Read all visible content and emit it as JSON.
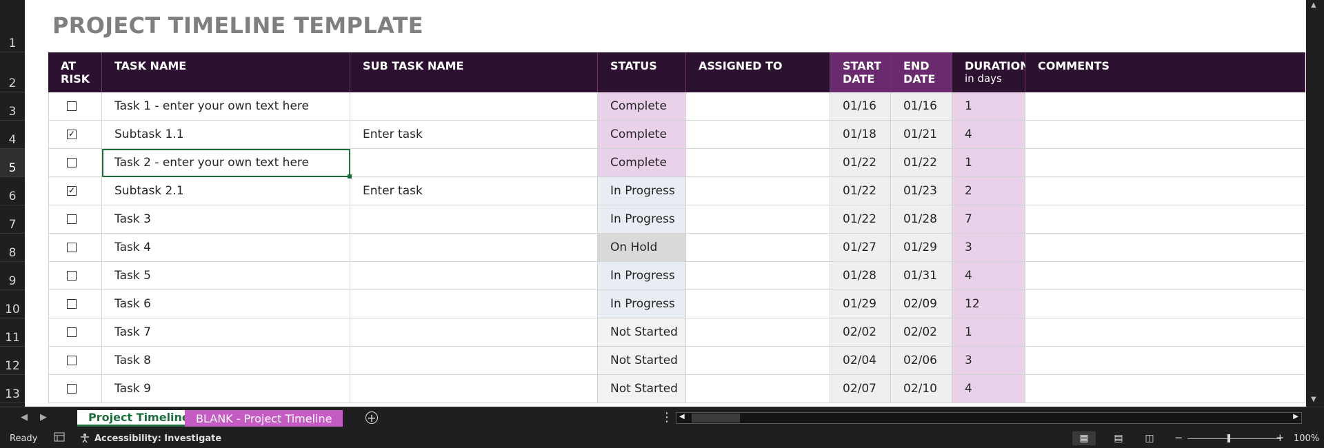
{
  "sheet": {
    "title": "PROJECT TIMELINE TEMPLATE",
    "row_numbers": [
      "1",
      "2",
      "3",
      "4",
      "5",
      "6",
      "7",
      "8",
      "9",
      "10",
      "11",
      "12",
      "13"
    ],
    "selected_row": "5",
    "headers": {
      "at_risk": "AT RISK",
      "task_name": "TASK NAME",
      "sub_task_name": "SUB TASK NAME",
      "status": "STATUS",
      "assigned_to": "ASSIGNED TO",
      "start_date": "START DATE",
      "end_date": "END DATE",
      "duration": "DURATION",
      "duration_unit": "in days",
      "comments": "COMMENTS"
    },
    "rows": [
      {
        "at_risk": false,
        "task": "Task 1 - enter your own text here",
        "subtask": "",
        "status": "Complete",
        "assigned": "",
        "start": "01/16",
        "end": "01/16",
        "duration": "1",
        "comments": ""
      },
      {
        "at_risk": true,
        "task": "Subtask 1.1",
        "subtask": "Enter task",
        "status": "Complete",
        "assigned": "",
        "start": "01/18",
        "end": "01/21",
        "duration": "4",
        "comments": ""
      },
      {
        "at_risk": false,
        "task": "Task 2 - enter your own text here",
        "subtask": "",
        "status": "Complete",
        "assigned": "",
        "start": "01/22",
        "end": "01/22",
        "duration": "1",
        "comments": ""
      },
      {
        "at_risk": true,
        "task": "Subtask 2.1",
        "subtask": "Enter task",
        "status": "In Progress",
        "assigned": "",
        "start": "01/22",
        "end": "01/23",
        "duration": "2",
        "comments": ""
      },
      {
        "at_risk": false,
        "task": "Task 3",
        "subtask": "",
        "status": "In Progress",
        "assigned": "",
        "start": "01/22",
        "end": "01/28",
        "duration": "7",
        "comments": ""
      },
      {
        "at_risk": false,
        "task": "Task 4",
        "subtask": "",
        "status": "On Hold",
        "assigned": "",
        "start": "01/27",
        "end": "01/29",
        "duration": "3",
        "comments": ""
      },
      {
        "at_risk": false,
        "task": "Task 5",
        "subtask": "",
        "status": "In Progress",
        "assigned": "",
        "start": "01/28",
        "end": "01/31",
        "duration": "4",
        "comments": ""
      },
      {
        "at_risk": false,
        "task": "Task 6",
        "subtask": "",
        "status": "In Progress",
        "assigned": "",
        "start": "01/29",
        "end": "02/09",
        "duration": "12",
        "comments": ""
      },
      {
        "at_risk": false,
        "task": "Task 7",
        "subtask": "",
        "status": "Not Started",
        "assigned": "",
        "start": "02/02",
        "end": "02/02",
        "duration": "1",
        "comments": ""
      },
      {
        "at_risk": false,
        "task": "Task 8",
        "subtask": "",
        "status": "Not Started",
        "assigned": "",
        "start": "02/04",
        "end": "02/06",
        "duration": "3",
        "comments": ""
      },
      {
        "at_risk": false,
        "task": "Task 9",
        "subtask": "",
        "status": "Not Started",
        "assigned": "",
        "start": "02/07",
        "end": "02/10",
        "duration": "4",
        "comments": ""
      }
    ]
  },
  "colors": {
    "header_dark": "#2c1130",
    "header_date": "#6a2a6e",
    "status_complete": "#ead1ea",
    "status_in_progress": "#e8edf4",
    "status_on_hold": "#d9d9d9",
    "status_not_started": "#f2f2f2",
    "date_bg": "#efefef",
    "duration_bg": "#ead1ea",
    "accent_green": "#1e6e3c"
  },
  "tabs": [
    {
      "label": "Project Timeline",
      "active": true
    },
    {
      "label": "BLANK - Project Timeline",
      "active": false
    }
  ],
  "status_bar": {
    "ready": "Ready",
    "accessibility": "Accessibility: Investigate",
    "zoom": "100%"
  },
  "icons": [
    "macro-record-icon",
    "accessibility-icon",
    "normal-view-icon",
    "page-layout-icon",
    "page-break-icon",
    "add-sheet-icon",
    "scroll-left-icon",
    "scroll-right-icon"
  ]
}
